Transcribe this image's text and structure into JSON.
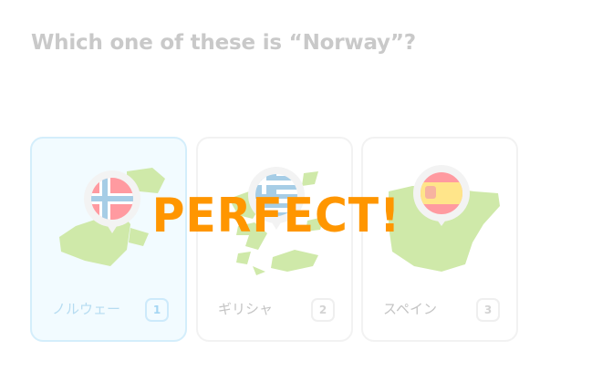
{
  "question": "Which one of these is “Norway”?",
  "choices": [
    {
      "label": "ノルウェー",
      "key": "1",
      "flag_icon": "norway-flag-icon",
      "selected": true
    },
    {
      "label": "ギリシャ",
      "key": "2",
      "flag_icon": "greece-flag-icon",
      "selected": false
    },
    {
      "label": "スペイン",
      "key": "3",
      "flag_icon": "spain-flag-icon",
      "selected": false
    }
  ],
  "feedback": "PERFECT!",
  "colors": {
    "feedback": "#ff9600",
    "map_land": "#cfe9a9",
    "selected_border": "#d4eefb",
    "selected_bg": "#f2fbff"
  }
}
